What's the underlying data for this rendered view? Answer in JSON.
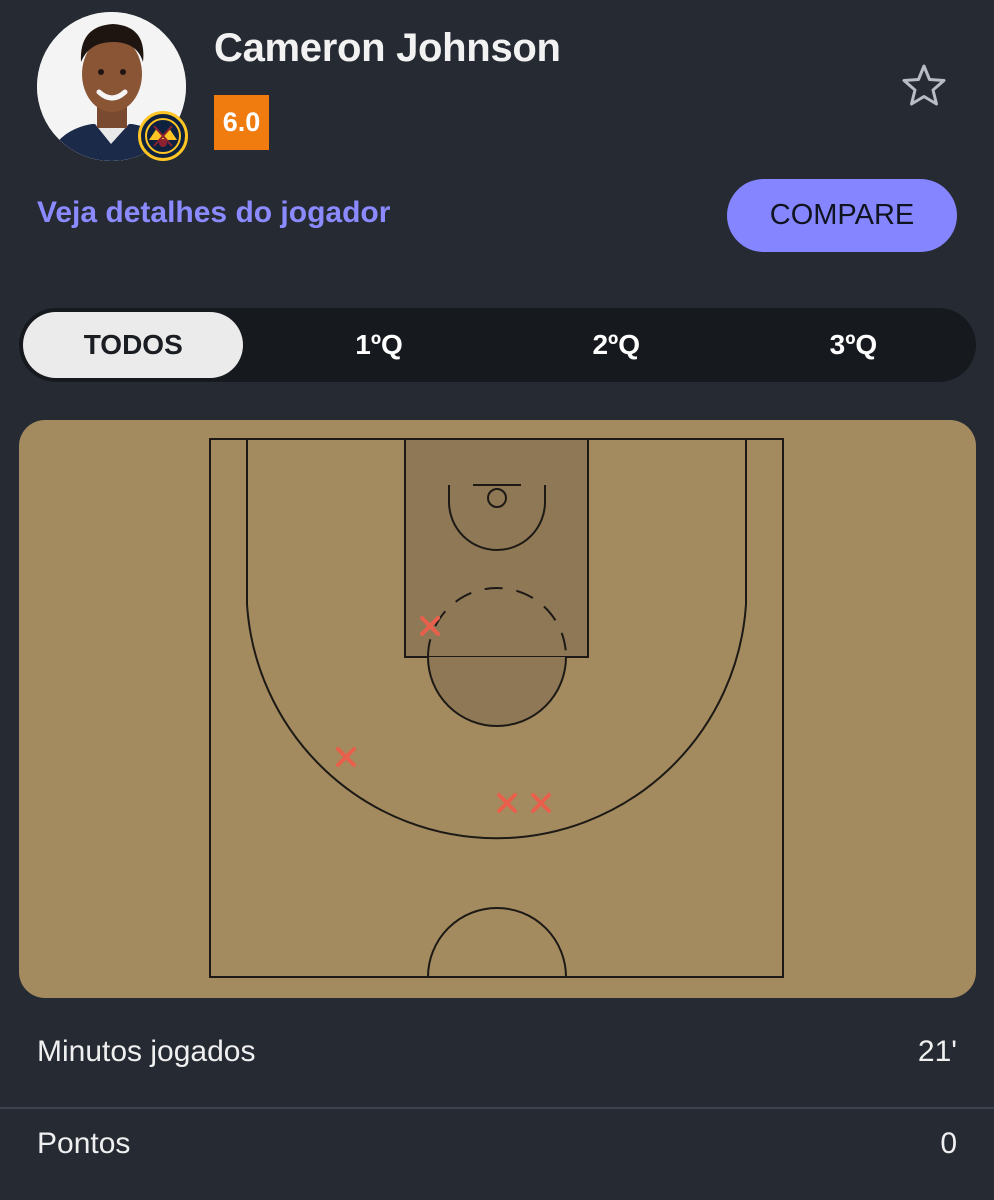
{
  "player": {
    "name": "Cameron Johnson",
    "rating": "6.0",
    "rating_color": "#f07c10",
    "team_logo_icon": "nuggets-logo-icon",
    "favorite_icon": "star-outline-icon"
  },
  "links": {
    "details": "Veja detalhes do jogador"
  },
  "actions": {
    "compare_label": "COMPARE"
  },
  "tabs": [
    {
      "label": "TODOS",
      "active": true
    },
    {
      "label": "1ºQ",
      "active": false
    },
    {
      "label": "2ºQ",
      "active": false
    },
    {
      "label": "3ºQ",
      "active": false
    }
  ],
  "shot_chart": {
    "court_color": "#a38b5f",
    "paint_color": "#8e7855",
    "missed_marker_color": "#e8604c",
    "shots": [
      {
        "result": "missed"
      },
      {
        "result": "missed"
      },
      {
        "result": "missed"
      },
      {
        "result": "missed"
      }
    ]
  },
  "stats": [
    {
      "label": "Minutos jogados",
      "value": "21'"
    },
    {
      "label": "Pontos",
      "value": "0"
    }
  ],
  "colors": {
    "background": "#252a33",
    "accent": "#8585ff",
    "link": "#8b8bff"
  }
}
